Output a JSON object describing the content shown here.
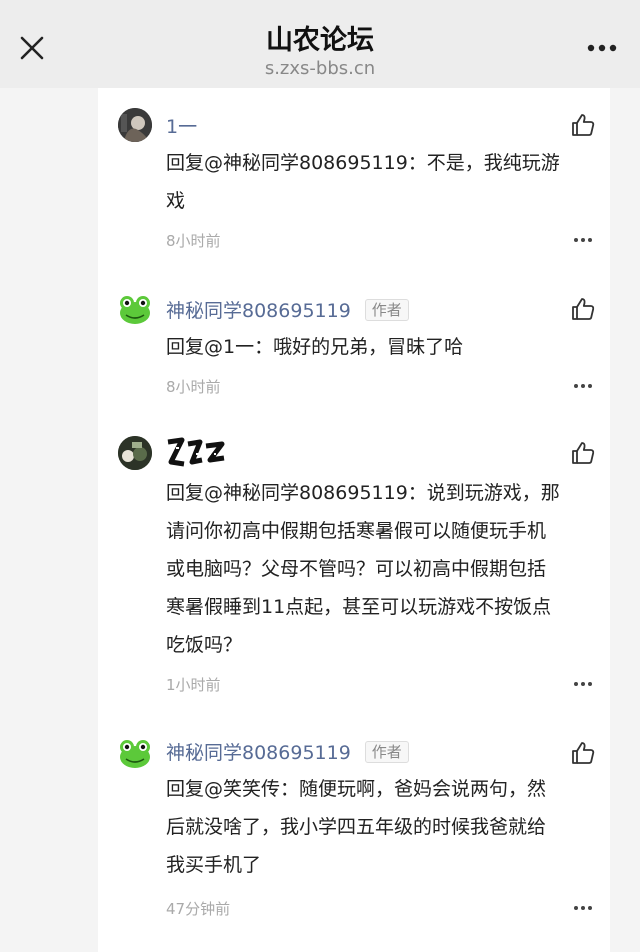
{
  "header": {
    "title": "山农论坛",
    "subtitle": "s.zxs-bbs.cn"
  },
  "comments": [
    {
      "author": "1一",
      "author_badge": "",
      "text_lines": [
        "回复@神秘同学808695119：不是，我纯玩游",
        "戏"
      ],
      "time": "8小时前"
    },
    {
      "author": "神秘同学808695119",
      "author_badge": "作者",
      "text_lines": [
        "回复@1一：哦好的兄弟，冒昧了哈"
      ],
      "time": "8小时前"
    },
    {
      "author": "",
      "author_badge": "",
      "text_lines": [
        "回复@神秘同学808695119：说到玩游戏，那",
        "请问你初高中假期包括寒暑假可以随便玩手机",
        "或电脑吗？父母不管吗？可以初高中假期包括",
        "寒暑假睡到11点起，甚至可以玩游戏不按饭点",
        "吃饭吗？"
      ],
      "time": "1小时前"
    },
    {
      "author": "神秘同学808695119",
      "author_badge": "作者",
      "text_lines": [
        "回复@笑笑传：随便玩啊，爸妈会说两句，然",
        "后就没啥了，我小学四五年级的时候我爸就给",
        "我买手机了"
      ],
      "time": "47分钟前"
    }
  ],
  "colors": {
    "header_bg": "#ededed",
    "name": "#576b95",
    "time": "#aaaaaa"
  },
  "icons": {
    "close": "close-icon",
    "more": "more-icon",
    "like": "thumbs-up-icon",
    "comment_more": "ellipsis-icon"
  }
}
